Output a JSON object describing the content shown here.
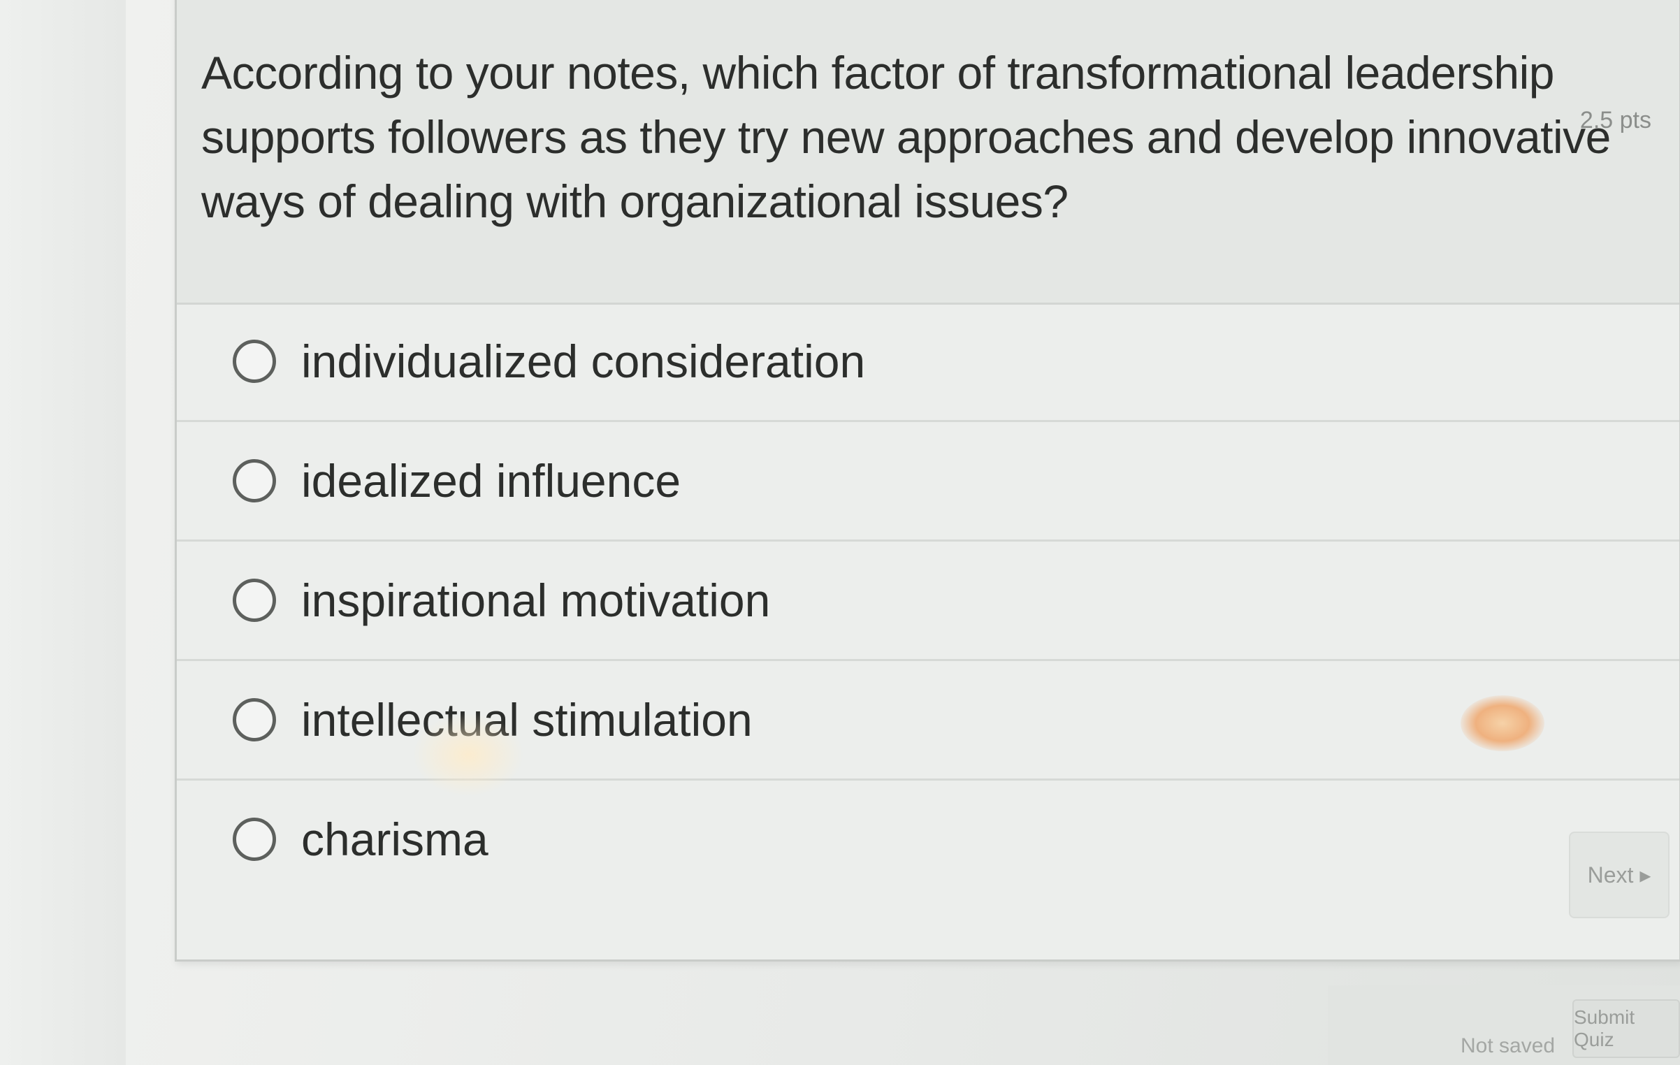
{
  "quiz": {
    "points": "2.5 pts",
    "question": "According to your notes, which factor of transformational leadership supports followers as they try new approaches and develop innovative ways of dealing with organizational issues?",
    "options": [
      "individualized consideration",
      "idealized influence",
      "inspirational motivation",
      "intellectual stimulation",
      "charisma"
    ]
  },
  "footer": {
    "next_label": "Next ▸",
    "status": "Not saved",
    "submit_label": "Submit Quiz"
  },
  "colors": {
    "card_background": "#eceeec",
    "text": "#2c2e2c",
    "radio_border": "#5d605d"
  }
}
